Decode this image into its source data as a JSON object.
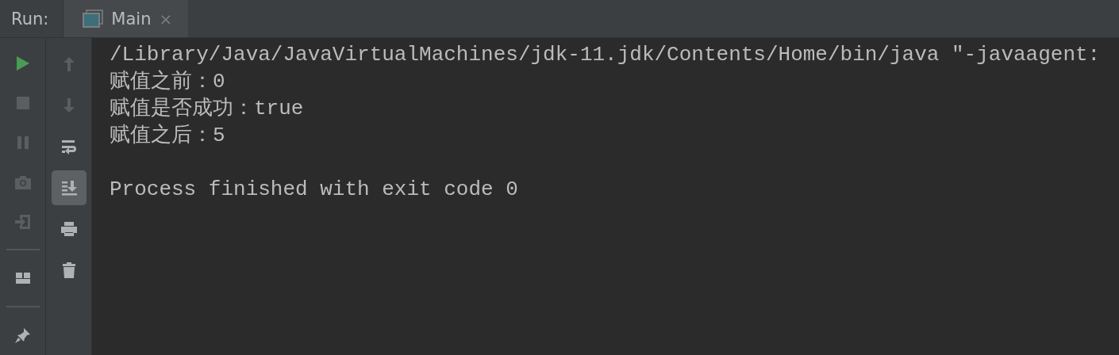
{
  "panel": {
    "label": "Run:"
  },
  "tabs": [
    {
      "label": "Main",
      "selected": true,
      "close": "×"
    }
  ],
  "left_toolbar": [
    {
      "disabled": false
    },
    {
      "disabled": true
    },
    {
      "disabled": true
    },
    {
      "disabled": true
    },
    {
      "disabled": true
    },
    {
      "disabled": false
    },
    {
      "disabled": false
    }
  ],
  "right_toolbar": [
    {
      "disabled": true,
      "selected": false
    },
    {
      "disabled": true,
      "selected": false
    },
    {
      "disabled": false,
      "selected": false
    },
    {
      "disabled": false,
      "selected": true
    },
    {
      "disabled": false,
      "selected": false
    },
    {
      "disabled": false,
      "selected": false
    }
  ],
  "console": {
    "lines": [
      "/Library/Java/JavaVirtualMachines/jdk-11.jdk/Contents/Home/bin/java \"-javaagent:",
      "赋值之前：0",
      "赋值是否成功：true",
      "赋值之后：5"
    ],
    "exit_message": "Process finished with exit code 0"
  }
}
